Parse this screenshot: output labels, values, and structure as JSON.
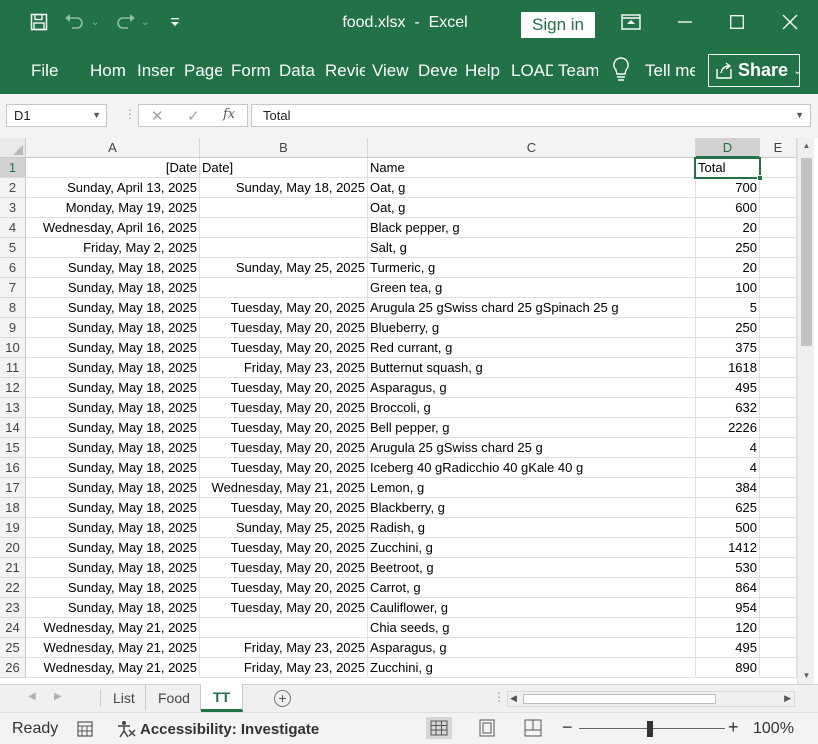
{
  "window": {
    "file_name": "food.xlsx",
    "app_name": "Excel",
    "title_sep": "-",
    "sign_in_label": "Sign in"
  },
  "ribbon": {
    "file_tab": "File",
    "tabs": [
      "Hom",
      "Inser",
      "Page",
      "Form",
      "Data",
      "Revie",
      "View",
      "Deve",
      "Help",
      "LOAD",
      "Team"
    ],
    "tell_me": "Tell me",
    "share_label": "Share"
  },
  "formula_bar": {
    "name_box": "D1",
    "formula": "Total"
  },
  "grid": {
    "columns": [
      "A",
      "B",
      "C",
      "D",
      "E"
    ],
    "selected_column": "D",
    "selected_row": 1,
    "header_row": {
      "A": "[Date",
      "B": "Date]",
      "C": "Name",
      "D": "Total"
    },
    "rows": [
      {
        "n": 2,
        "a": "Sunday, April 13, 2025",
        "b": "Sunday, May 18, 2025",
        "c": "Oat, g",
        "d": "700"
      },
      {
        "n": 3,
        "a": "Monday, May 19, 2025",
        "b": "",
        "c": "Oat, g",
        "d": "600"
      },
      {
        "n": 4,
        "a": "Wednesday, April 16, 2025",
        "b": "",
        "c": "Black pepper, g",
        "d": "20"
      },
      {
        "n": 5,
        "a": "Friday, May 2, 2025",
        "b": "",
        "c": "Salt, g",
        "d": "250"
      },
      {
        "n": 6,
        "a": "Sunday, May 18, 2025",
        "b": "Sunday, May 25, 2025",
        "c": "Turmeric, g",
        "d": "20"
      },
      {
        "n": 7,
        "a": "Sunday, May 18, 2025",
        "b": "",
        "c": "Green tea, g",
        "d": "100"
      },
      {
        "n": 8,
        "a": "Sunday, May 18, 2025",
        "b": "Tuesday, May 20, 2025",
        "c": "Arugula 25 gSwiss chard 25 gSpinach 25 g",
        "d": "5"
      },
      {
        "n": 9,
        "a": "Sunday, May 18, 2025",
        "b": "Tuesday, May 20, 2025",
        "c": "Blueberry, g",
        "d": "250"
      },
      {
        "n": 10,
        "a": "Sunday, May 18, 2025",
        "b": "Tuesday, May 20, 2025",
        "c": "Red currant, g",
        "d": "375"
      },
      {
        "n": 11,
        "a": "Sunday, May 18, 2025",
        "b": "Friday, May 23, 2025",
        "c": "Butternut squash, g",
        "d": "1618"
      },
      {
        "n": 12,
        "a": "Sunday, May 18, 2025",
        "b": "Tuesday, May 20, 2025",
        "c": "Asparagus, g",
        "d": "495"
      },
      {
        "n": 13,
        "a": "Sunday, May 18, 2025",
        "b": "Tuesday, May 20, 2025",
        "c": "Broccoli, g",
        "d": "632"
      },
      {
        "n": 14,
        "a": "Sunday, May 18, 2025",
        "b": "Tuesday, May 20, 2025",
        "c": "Bell pepper, g",
        "d": "2226"
      },
      {
        "n": 15,
        "a": "Sunday, May 18, 2025",
        "b": "Tuesday, May 20, 2025",
        "c": "Arugula 25 gSwiss chard 25 g",
        "d": "4"
      },
      {
        "n": 16,
        "a": "Sunday, May 18, 2025",
        "b": "Tuesday, May 20, 2025",
        "c": "Iceberg 40 gRadicchio 40 gKale 40 g",
        "d": "4"
      },
      {
        "n": 17,
        "a": "Sunday, May 18, 2025",
        "b": "Wednesday, May 21, 2025",
        "c": "Lemon, g",
        "d": "384"
      },
      {
        "n": 18,
        "a": "Sunday, May 18, 2025",
        "b": "Tuesday, May 20, 2025",
        "c": "Blackberry, g",
        "d": "625"
      },
      {
        "n": 19,
        "a": "Sunday, May 18, 2025",
        "b": "Sunday, May 25, 2025",
        "c": "Radish, g",
        "d": "500"
      },
      {
        "n": 20,
        "a": "Sunday, May 18, 2025",
        "b": "Tuesday, May 20, 2025",
        "c": "Zucchini, g",
        "d": "1412"
      },
      {
        "n": 21,
        "a": "Sunday, May 18, 2025",
        "b": "Tuesday, May 20, 2025",
        "c": "Beetroot, g",
        "d": "530"
      },
      {
        "n": 22,
        "a": "Sunday, May 18, 2025",
        "b": "Tuesday, May 20, 2025",
        "c": "Carrot, g",
        "d": "864"
      },
      {
        "n": 23,
        "a": "Sunday, May 18, 2025",
        "b": "Tuesday, May 20, 2025",
        "c": "Cauliflower, g",
        "d": "954"
      },
      {
        "n": 24,
        "a": "Wednesday, May 21, 2025",
        "b": "",
        "c": "Chia seeds, g",
        "d": "120"
      },
      {
        "n": 25,
        "a": "Wednesday, May 21, 2025",
        "b": "Friday, May 23, 2025",
        "c": "Asparagus, g",
        "d": "495"
      },
      {
        "n": 26,
        "a": "Wednesday, May 21, 2025",
        "b": "Friday, May 23, 2025",
        "c": "Zucchini, g",
        "d": "890"
      }
    ]
  },
  "sheets": {
    "tabs": [
      "List",
      "Food",
      "TT"
    ],
    "active": "TT"
  },
  "status_bar": {
    "ready": "Ready",
    "accessibility": "Accessibility: Investigate",
    "zoom": "100%"
  },
  "colors": {
    "brand": "#217346",
    "ribbon_text": "#ffffff"
  }
}
